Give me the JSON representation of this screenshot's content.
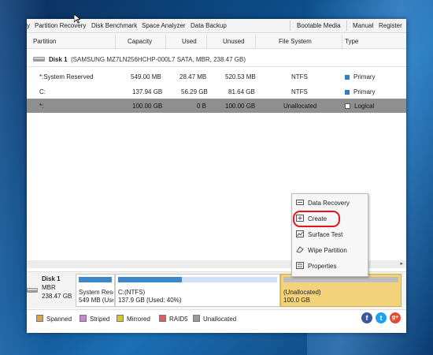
{
  "menu": [
    "Partition Recovery",
    "Disk Benchmark",
    "Space Analyzer",
    "Data Backup",
    "Bootable Media",
    "Manual",
    "Register"
  ],
  "columns": [
    "Partition",
    "Capacity",
    "Used",
    "Unused",
    "File System",
    "Type"
  ],
  "disk": {
    "label": "Disk 1",
    "details": "(SAMSUNG MZ7LN256HCHP-000L7 SATA, MBR, 238.47 GB)"
  },
  "partitions": [
    {
      "name": "*:System Reserved",
      "capacity": "549.00 MB",
      "used": "28.47 MB",
      "unused": "520.53 MB",
      "fs": "NTFS",
      "type": "Primary",
      "type_color": "#2f7fc4"
    },
    {
      "name": "C:",
      "capacity": "137.94 GB",
      "used": "56.29 GB",
      "unused": "81.64 GB",
      "fs": "NTFS",
      "type": "Primary",
      "type_color": "#2f7fc4"
    },
    {
      "name": "*:",
      "capacity": "100.00 GB",
      "used": "0 B",
      "unused": "100.00 GB",
      "fs": "Unallocated",
      "type": "Logical",
      "type_color": "#ffffff",
      "selected": true
    }
  ],
  "context_menu": [
    "Data Recovery",
    "Create",
    "Surface Test",
    "Wipe Partition",
    "Properties"
  ],
  "diskmap": {
    "disk_name": "Disk 1",
    "disk_type": "MBR",
    "disk_size": "238.47 GB",
    "blocks": [
      {
        "label": "System Rese",
        "size": "549 MB (Use",
        "fill": 0.05
      },
      {
        "label": "C:(NTFS)",
        "size": "137.9 GB (Used: 40%)",
        "fill": 0.4
      },
      {
        "label": "(Unallocated)",
        "size": "100.0 GB",
        "fill": 0
      }
    ]
  },
  "legend": [
    {
      "label": "Spanned",
      "color": "#d9a34a"
    },
    {
      "label": "Striped",
      "color": "#c584d6"
    },
    {
      "label": "Mirrored",
      "color": "#d8c628"
    },
    {
      "label": "RAID5",
      "color": "#e25a5a"
    },
    {
      "label": "Unallocated",
      "color": "#9a9a9a"
    }
  ],
  "social": [
    "f",
    "t",
    "g+"
  ]
}
